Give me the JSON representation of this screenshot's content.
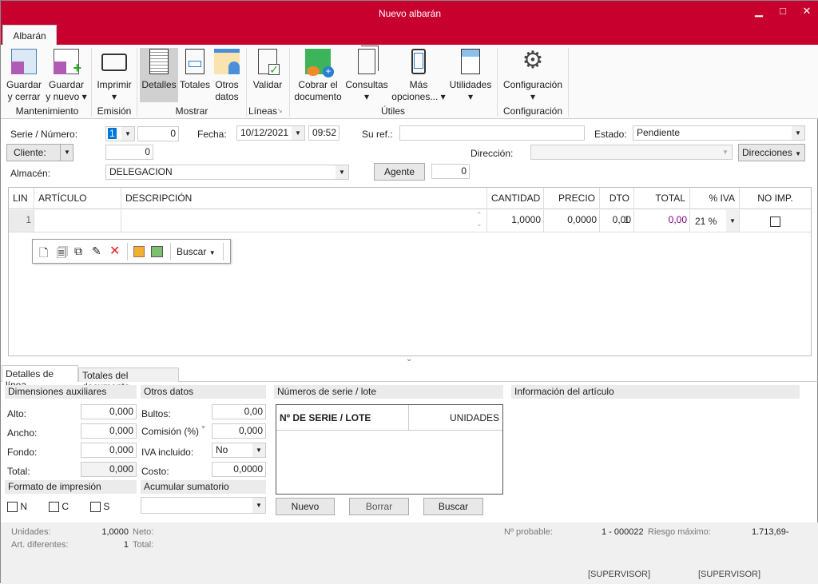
{
  "window": {
    "title": "Nuevo albarán",
    "minimize": "▁",
    "maximize": "□",
    "close": "✕"
  },
  "ribbon": {
    "tab": "Albarán",
    "buttons": [
      {
        "label1": "Guardar",
        "label2": "y cerrar"
      },
      {
        "label1": "Guardar",
        "label2": "y nuevo ▾"
      },
      {
        "label1": "Imprimir",
        "label2": "▾"
      },
      {
        "label1": "Detalles",
        "label2": ""
      },
      {
        "label1": "Totales",
        "label2": ""
      },
      {
        "label1": "Otros",
        "label2": "datos"
      },
      {
        "label1": "Validar",
        "label2": ""
      },
      {
        "label1": "Cobrar el",
        "label2": "documento"
      },
      {
        "label1": "Consultas",
        "label2": "▾"
      },
      {
        "label1": "Más",
        "label2": "opciones... ▾"
      },
      {
        "label1": "Utilidades",
        "label2": "▾"
      },
      {
        "label1": "Configuración",
        "label2": "▾"
      }
    ],
    "groups": [
      "Mantenimiento",
      "Emisión",
      "Mostrar",
      "Líneas",
      "Útiles",
      "Configuración"
    ]
  },
  "header": {
    "serie_label": "Serie / Número:",
    "serie": "1",
    "numero": "0",
    "fecha_label": "Fecha:",
    "fecha": "10/12/2021",
    "hora": "09:52",
    "suref_label": "Su ref.:",
    "suref": "",
    "estado_label": "Estado:",
    "estado": "Pendiente",
    "cliente_label": "Cliente:",
    "cliente": "0",
    "direccion_label": "Dirección:",
    "direccion": "",
    "direcciones_btn": "Direcciones",
    "almacen_label": "Almacén:",
    "almacen": "DELEGACION",
    "agente_btn": "Agente",
    "agente": "0"
  },
  "lines": {
    "columns": [
      "LIN",
      "ARTÍCULO",
      "DESCRIPCIÓN",
      "CANTIDAD",
      "PRECIO",
      "DTO 1",
      "TOTAL",
      "% IVA",
      "NO IMP."
    ],
    "rows": [
      {
        "lin": "1",
        "articulo": "",
        "descripcion": "",
        "cantidad": "1,0000",
        "precio": "0,0000",
        "dto": "0,00",
        "total": "0,00",
        "iva": "21 %",
        "noimp": false
      }
    ],
    "toolbar": {
      "search": "Buscar"
    },
    "total_color": "#800080"
  },
  "bottom_tabs": [
    "Detalles de línea",
    "Totales del documento"
  ],
  "dimensiones": {
    "title": "Dimensiones auxiliares",
    "alto_label": "Alto:",
    "alto": "0,000",
    "ancho_label": "Ancho:",
    "ancho": "0,000",
    "fondo_label": "Fondo:",
    "fondo": "0,000",
    "total_label": "Total:",
    "total": "0,000"
  },
  "otros": {
    "title": "Otros datos",
    "bultos_label": "Bultos:",
    "bultos": "0,00",
    "comision_label": "Comisión (%)",
    "comision": "0,000",
    "iva_label": "IVA incluido:",
    "iva": "No",
    "costo_label": "Costo:",
    "costo": "0,0000"
  },
  "formato": {
    "title": "Formato de impresión",
    "options": [
      "N",
      "C",
      "S"
    ]
  },
  "acumular": {
    "title": "Acumular sumatorio",
    "value": ""
  },
  "series": {
    "title": "Números de serie / lote",
    "col1": "Nº DE SERIE / LOTE",
    "col2": "UNIDADES",
    "nuevo": "Nuevo",
    "borrar": "Borrar",
    "buscar": "Buscar"
  },
  "info": {
    "title": "Información del artículo"
  },
  "status": {
    "unidades_label": "Unidades:",
    "unidades": "1,0000",
    "neto_label": "Neto:",
    "art_label": "Art. diferentes:",
    "art": "1",
    "total_label": "Total:",
    "probable_label": "Nº probable:",
    "probable": "1 - 000022",
    "riesgo_label": "Riesgo máximo:",
    "riesgo": "1.713,69-",
    "user1": "[SUPERVISOR]",
    "user2": "[SUPERVISOR]"
  }
}
